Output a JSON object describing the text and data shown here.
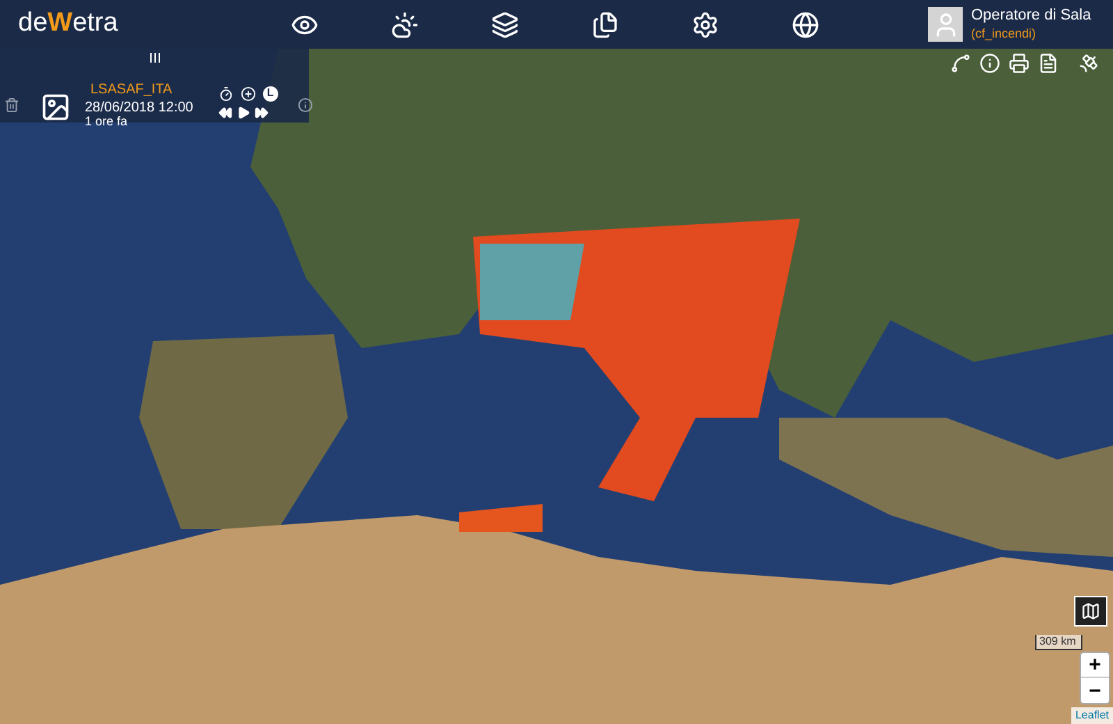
{
  "topbar": {
    "logo": [
      "de",
      "W",
      "etra"
    ],
    "user": {
      "name": "Operatore di Sala",
      "role": "(cf_incendi)"
    }
  },
  "layer_panel": {
    "name": "LSASAF_ITA",
    "datetime": "28/06/2018 12:00",
    "age": "1 ore fa",
    "badge": "L"
  },
  "map": {
    "scale": "309 km",
    "zoom_in": "+",
    "zoom_out": "−",
    "attribution": "Leaflet"
  }
}
